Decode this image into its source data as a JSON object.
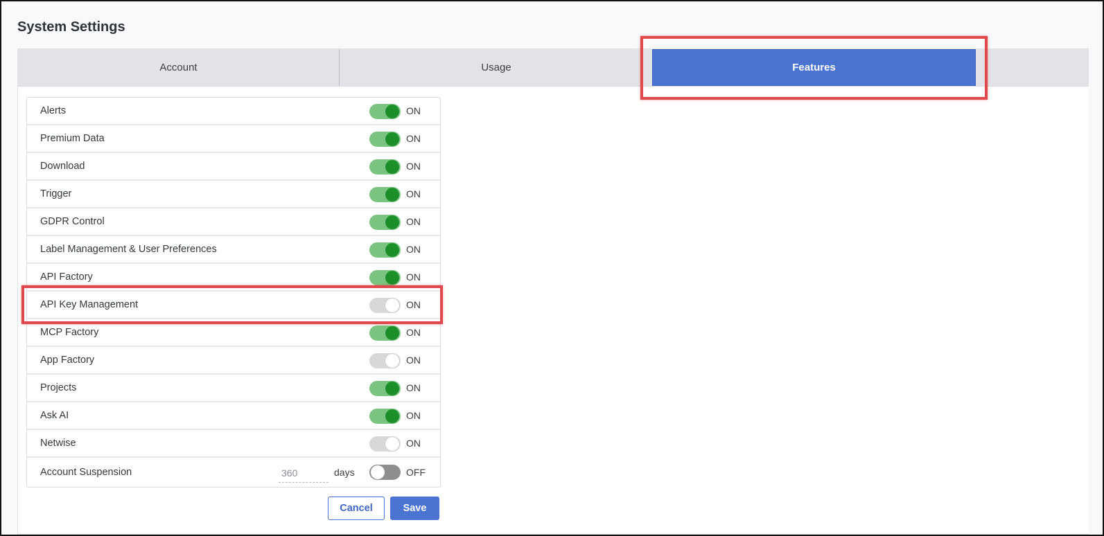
{
  "page": {
    "title": "System Settings"
  },
  "tabs": [
    {
      "label": "Account",
      "active": false
    },
    {
      "label": "Usage",
      "active": false
    },
    {
      "label": "Features",
      "active": true
    }
  ],
  "features": [
    {
      "label": "Alerts",
      "state": "ON",
      "toggle": "on"
    },
    {
      "label": "Premium Data",
      "state": "ON",
      "toggle": "on"
    },
    {
      "label": "Download",
      "state": "ON",
      "toggle": "on"
    },
    {
      "label": "Trigger",
      "state": "ON",
      "toggle": "on"
    },
    {
      "label": "GDPR Control",
      "state": "ON",
      "toggle": "on"
    },
    {
      "label": "Label Management & User Preferences",
      "state": "ON",
      "toggle": "on"
    },
    {
      "label": "API Factory",
      "state": "ON",
      "toggle": "on"
    },
    {
      "label": "API Key Management",
      "state": "ON",
      "toggle": "disabled"
    },
    {
      "label": "MCP Factory",
      "state": "ON",
      "toggle": "on"
    },
    {
      "label": "App Factory",
      "state": "ON",
      "toggle": "disabled"
    },
    {
      "label": "Projects",
      "state": "ON",
      "toggle": "on"
    },
    {
      "label": "Ask AI",
      "state": "ON",
      "toggle": "on"
    },
    {
      "label": "Netwise",
      "state": "ON",
      "toggle": "disabled"
    }
  ],
  "account_suspension": {
    "label": "Account Suspension",
    "days_value": "360",
    "days_unit": "days",
    "state": "OFF",
    "toggle": "off"
  },
  "buttons": {
    "cancel": "Cancel",
    "save": "Save"
  },
  "colors": {
    "accent": "#4a73d2",
    "toggle_on_track": "#7bc47f",
    "toggle_on_knob": "#1d8f2a",
    "highlight": "#e0484b"
  },
  "icons": []
}
